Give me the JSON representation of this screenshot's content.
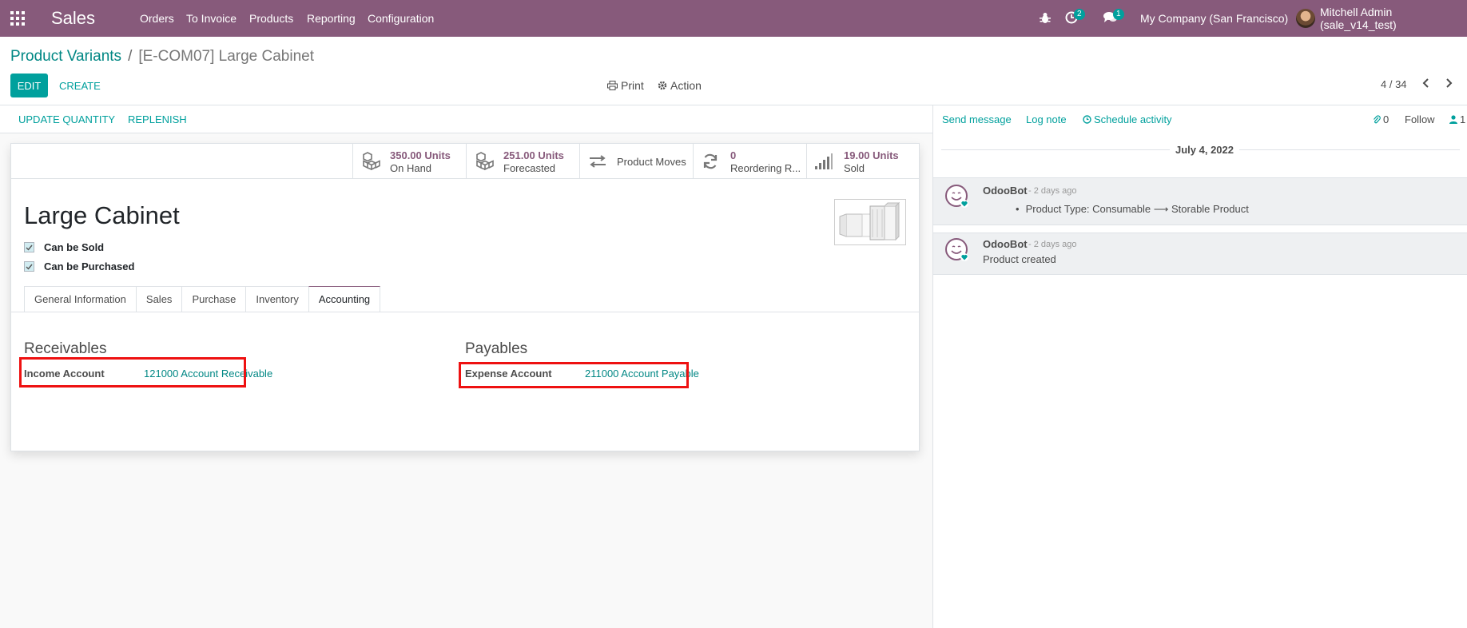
{
  "navbar": {
    "app_name": "Sales",
    "menu": [
      "Orders",
      "To Invoice",
      "Products",
      "Reporting",
      "Configuration"
    ],
    "activity_count": "2",
    "message_count": "1",
    "company": "My Company (San Francisco)",
    "user": "Mitchell Admin (sale_v14_test)"
  },
  "breadcrumb": {
    "parent": "Product Variants",
    "separator": "/",
    "current": "[E-COM07] Large Cabinet"
  },
  "toolbar": {
    "edit": "EDIT",
    "create": "CREATE",
    "print": "Print",
    "action": "Action",
    "pager": "4 / 34"
  },
  "statusbar": {
    "update_quantity": "UPDATE QUANTITY",
    "replenish": "REPLENISH"
  },
  "stat_buttons": [
    {
      "value": "350.00 Units",
      "label": "On Hand",
      "icon": "cubes-icon"
    },
    {
      "value": "251.00 Units",
      "label": "Forecasted",
      "icon": "cubes-icon"
    },
    {
      "value": "",
      "label": "Product Moves",
      "icon": "exchange-icon"
    },
    {
      "value": "0",
      "label": "Reordering R...",
      "icon": "refresh-icon"
    },
    {
      "value": "19.00 Units",
      "label": "Sold",
      "icon": "signal-icon"
    }
  ],
  "product": {
    "name": "Large Cabinet",
    "can_be_sold": "Can be Sold",
    "can_be_purchased": "Can be Purchased"
  },
  "tabs": [
    "General Information",
    "Sales",
    "Purchase",
    "Inventory",
    "Accounting"
  ],
  "active_tab": "Accounting",
  "accounting": {
    "receivables_title": "Receivables",
    "income_label": "Income Account",
    "income_value": "121000 Account Receivable",
    "payables_title": "Payables",
    "expense_label": "Expense Account",
    "expense_value": "211000 Account Payable"
  },
  "chatter": {
    "send_message": "Send message",
    "log_note": "Log note",
    "schedule_activity": "Schedule activity",
    "attachments": "0",
    "follow": "Follow",
    "followers": "1",
    "date": "July 4, 2022",
    "messages": [
      {
        "author": "OdooBot",
        "date": "- 2 days ago",
        "body": "Product Type: Consumable ⟶ Storable Product"
      },
      {
        "author": "OdooBot",
        "date": "- 2 days ago",
        "body": "Product created"
      }
    ]
  },
  "colors": {
    "navbar": "#875a7b",
    "accent": "#00a09d",
    "link": "#008784",
    "highlight_box": "#ee1111"
  }
}
